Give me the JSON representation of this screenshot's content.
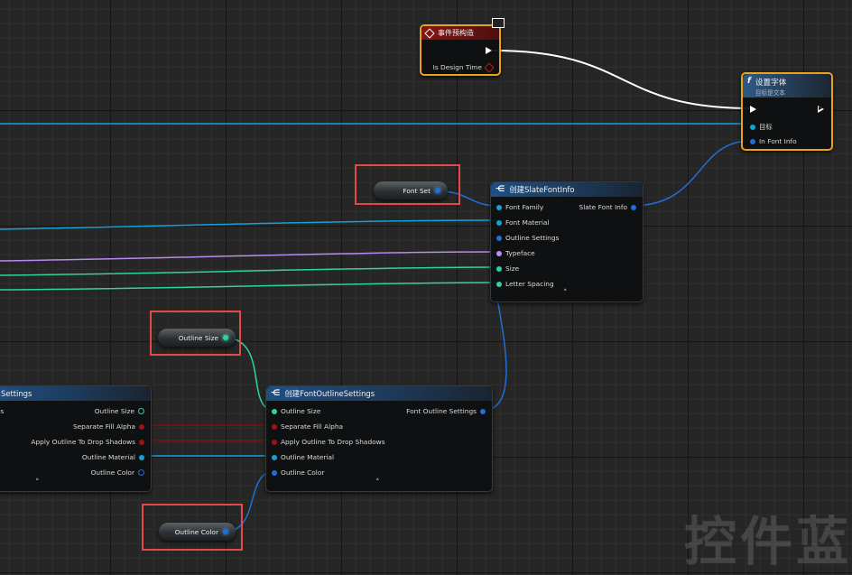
{
  "event_node": {
    "title": "事件预构造",
    "exec_out_label": "",
    "pin_label": "Is Design Time"
  },
  "set_font_node": {
    "title": "设置字体",
    "subtitle": "目标是文本",
    "pins": [
      "目标",
      "In Font Info"
    ]
  },
  "make_slate_font_node": {
    "title": "创建SlateFontInfo",
    "inputs": [
      "Font Family",
      "Font Material",
      "Outline Settings",
      "Typeface",
      "Size",
      "Letter Spacing"
    ],
    "output": "Slate Font Info"
  },
  "make_outline_node": {
    "title": "创建FontOutlineSettings",
    "inputs": [
      "Outline Size",
      "Separate Fill Alpha",
      "Apply Outline To Drop Shadows",
      "Outline Material",
      "Outline Color"
    ],
    "output": "Font Outline Settings"
  },
  "break_outline_node": {
    "title": "Settings",
    "input_label": "ngs",
    "outputs": [
      "Outline Size",
      "Separate Fill Alpha",
      "Apply Outline To Drop Shadows",
      "Outline Material",
      "Outline Color"
    ]
  },
  "variables": {
    "font_set": "Font Set",
    "outline_size": "Outline Size",
    "outline_color": "Outline Color"
  },
  "watermark": "控件蓝",
  "colors": {
    "struct_pin": "#1f6fd6",
    "object_pin": "#12a2d8",
    "float_pin": "#2fd39e",
    "bool_pin": "#9a1414",
    "name_pin": "#c08cf0",
    "exec_wire": "#ffffff",
    "highlight": "#e24a4a",
    "event_border": "#e8a21c"
  }
}
